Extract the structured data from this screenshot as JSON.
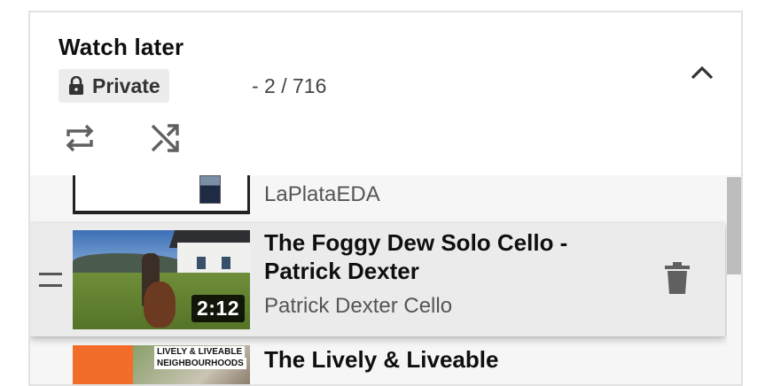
{
  "playlist": {
    "title": "Watch later",
    "privacy": "Private",
    "position": "- 2 / 716",
    "icons": {
      "lock": "lock-icon",
      "collapse": "chevron-up-icon",
      "loop": "loop-icon",
      "shuffle": "shuffle-icon",
      "drag": "drag-handle-icon",
      "delete": "trash-icon"
    }
  },
  "videos": [
    {
      "title": "",
      "channel": "LaPlataEDA",
      "duration": ""
    },
    {
      "title": "The Foggy Dew Solo Cello - Patrick Dexter",
      "channel": "Patrick Dexter Cello",
      "duration": "2:12"
    },
    {
      "title": "The Lively & Liveable",
      "channel": "",
      "duration": "",
      "thumbnail_text": [
        "LIVELY & LIVEABLE",
        "NEIGHBOURHOODS"
      ]
    }
  ],
  "colors": {
    "active_row": "#ebebeb",
    "list_bg": "#f6f6f6",
    "icon": "#606060"
  }
}
